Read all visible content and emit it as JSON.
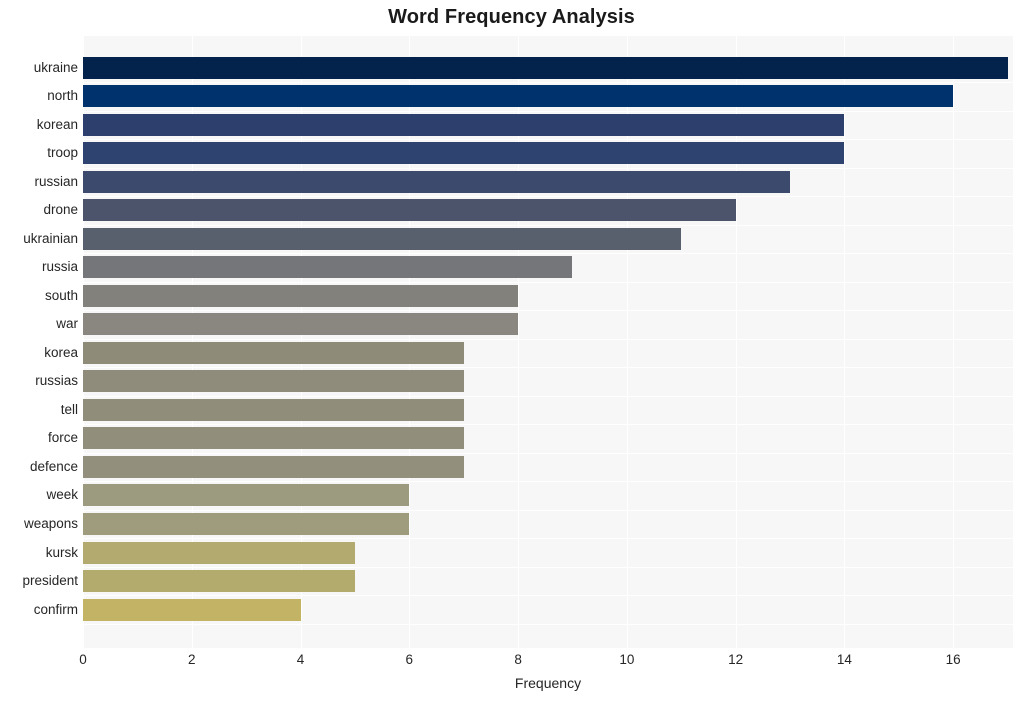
{
  "chart_data": {
    "type": "bar",
    "orientation": "horizontal",
    "title": "Word Frequency Analysis",
    "xlabel": "Frequency",
    "ylabel": "",
    "xlim": [
      0,
      17.1
    ],
    "ylim_categories_order": "descending-by-value",
    "grid": true,
    "legend": "none",
    "xticks": [
      0,
      2,
      4,
      6,
      8,
      10,
      12,
      14,
      16
    ],
    "xtick_labels": [
      "0",
      "2",
      "4",
      "6",
      "8",
      "10",
      "12",
      "14",
      "16"
    ],
    "categories": [
      "ukraine",
      "north",
      "korean",
      "troop",
      "russian",
      "drone",
      "ukrainian",
      "russia",
      "south",
      "war",
      "korea",
      "russias",
      "tell",
      "force",
      "defence",
      "week",
      "weapons",
      "kursk",
      "president",
      "confirm"
    ],
    "values": [
      17,
      16,
      14,
      14,
      13,
      12,
      11,
      9,
      8,
      8,
      7,
      7,
      7,
      7,
      7,
      6,
      6,
      5,
      5,
      4
    ],
    "bar_colors": [
      "#03234d",
      "#00336e",
      "#2d3f6c",
      "#2f4370",
      "#3c4a6e",
      "#4b546b",
      "#59606d",
      "#74767a",
      "#83817c",
      "#8a8780",
      "#8e8b79",
      "#8f8c7b",
      "#908d7b",
      "#918e7c",
      "#928f7d",
      "#9c9a7f",
      "#9f9c7d",
      "#b2aa6e",
      "#b3ab6d",
      "#c2b464"
    ],
    "plot_background": "#f7f7f7",
    "gridline_color": "#ffffff",
    "page_background": "#ffffff",
    "title_color": "#1a1a1a",
    "tick_label_color": "#262626"
  }
}
